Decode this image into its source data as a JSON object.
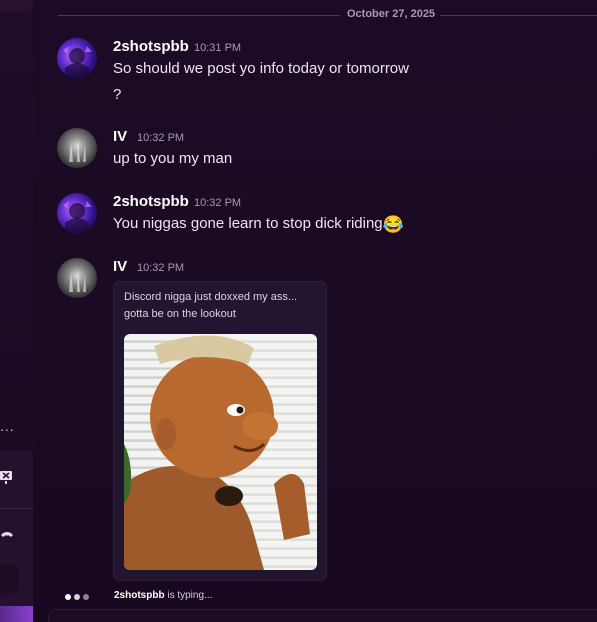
{
  "divider": {
    "date": "October 27, 2025"
  },
  "sidebar": {
    "ellipsis": "...",
    "icons": [
      "screen-share-off-icon",
      "phone-icon"
    ]
  },
  "messages": [
    {
      "username": "2shotspbb",
      "time": "10:31 PM",
      "lines": [
        "So should we post yo info today or tomorrow",
        "?"
      ],
      "avatar": "purple"
    },
    {
      "username": "IV",
      "time": "10:32 PM",
      "lines": [
        "up to you my man"
      ],
      "avatar": "gray"
    },
    {
      "username": "2shotspbb",
      "time": "10:32 PM",
      "lines": [
        "You niggas gone learn to stop dick riding"
      ],
      "emoji": "😂",
      "avatar": "purple"
    },
    {
      "username": "IV",
      "time": "10:32 PM",
      "lines": [],
      "avatar": "gray"
    }
  ],
  "embed": {
    "caption_line1": "Discord nigga just doxxed my ass...",
    "caption_line2": "gotta be on the lookout"
  },
  "typing": {
    "user": "2shotspbb",
    "suffix": " is typing..."
  },
  "colors": {
    "background": "#1a0b24",
    "accent": "#8a3fd0",
    "text": "#ede4f3",
    "muted": "#a898b5"
  }
}
